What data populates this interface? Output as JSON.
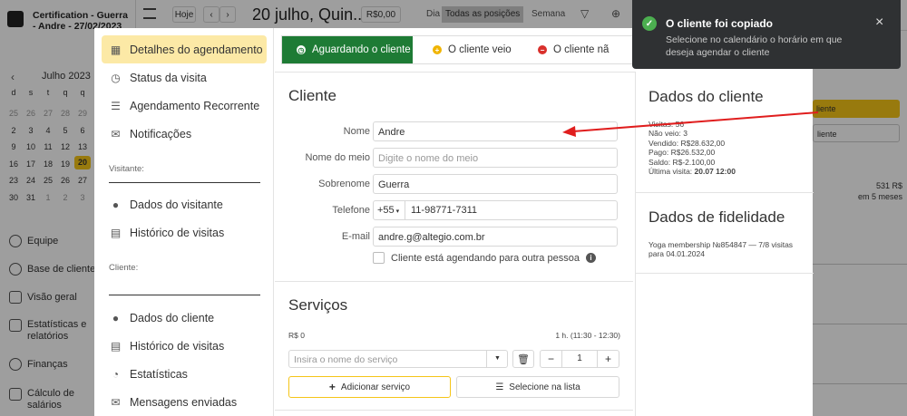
{
  "background": {
    "certification": "Certification - Guerra - Andre - 27/02/2023",
    "today_button": "Hoje",
    "date_title": "20 julho, Quin...",
    "price_pill": "R$0,00",
    "view_day": "Dia",
    "view_positions": "Todas as posições",
    "view_week": "Semana",
    "month_label": "Julho 2023",
    "weekdays": [
      "d",
      "s",
      "t",
      "q",
      "q"
    ],
    "calendar_rows": [
      [
        "25",
        "26",
        "27",
        "28",
        "29"
      ],
      [
        "2",
        "3",
        "4",
        "5",
        "6"
      ],
      [
        "9",
        "10",
        "11",
        "12",
        "13"
      ],
      [
        "16",
        "17",
        "18",
        "19",
        "20"
      ],
      [
        "23",
        "24",
        "25",
        "26",
        "27"
      ],
      [
        "30",
        "31",
        "1",
        "2",
        "3"
      ]
    ],
    "nav": [
      "Equipe",
      "Base de clientes",
      "Visão geral",
      "Estatísticas e relatórios",
      "Finanças",
      "Cálculo de salários"
    ],
    "right_snippets": [
      "liente",
      "liente",
      "531 R$",
      "em 5 meses"
    ]
  },
  "modal": {
    "sidebar": {
      "items_top": [
        {
          "label": "Detalhes do agendamento",
          "icon": "calendar-icon"
        },
        {
          "label": "Status da visita",
          "icon": "clock-icon"
        },
        {
          "label": "Agendamento Recorrente",
          "icon": "list-icon"
        },
        {
          "label": "Notificações",
          "icon": "chat-icon"
        }
      ],
      "visitor_label": "Visitante:",
      "items_visitor": [
        {
          "label": "Dados do visitante",
          "icon": "user-icon"
        },
        {
          "label": "Histórico de visitas",
          "icon": "history-icon"
        }
      ],
      "client_label": "Cliente:",
      "items_client": [
        {
          "label": "Dados do cliente",
          "icon": "user-icon"
        },
        {
          "label": "Histórico de visitas",
          "icon": "history-icon"
        },
        {
          "label": "Estatísticas",
          "icon": "pie-icon"
        },
        {
          "label": "Mensagens enviadas",
          "icon": "mail-icon"
        }
      ]
    },
    "tabs": {
      "waiting": "Aguardando o cliente",
      "came": "O cliente veio",
      "not_came": "O cliente nã"
    },
    "client": {
      "heading": "Cliente",
      "name_label": "Nome",
      "name_value": "Andre",
      "middle_label": "Nome do meio",
      "middle_placeholder": "Digite o nome do meio",
      "surname_label": "Sobrenome",
      "surname_value": "Guerra",
      "phone_label": "Telefone",
      "phone_code": "+55",
      "phone_value": "11-98771-7311",
      "email_label": "E-mail",
      "email_value": "andre.g@altegio.com.br",
      "other_person_label": "Cliente está agendando para outra pessoa"
    },
    "services": {
      "heading": "Serviços",
      "price": "R$ 0",
      "duration": "1 h. (11:30 - 12:30)",
      "service_placeholder": "Insira o nome do serviço",
      "quantity": "1",
      "add_service": "Adicionar serviço",
      "select_list": "Selecione na lista"
    },
    "client_data": {
      "heading": "Dados do cliente",
      "lines": [
        "Visitas: 56",
        "Não veio: 3",
        "Vendido: R$28.632,00",
        "Pago: R$26.532,00",
        "Saldo: R$-2.100,00"
      ],
      "last_visit_label": "Última visita: ",
      "last_visit_value": "20.07 12:00"
    },
    "loyalty": {
      "heading": "Dados de fidelidade",
      "text": "Yoga membership №854847 — 7/8 visitas para 04.01.2024"
    }
  },
  "toast": {
    "title": "O cliente foi copiado",
    "message": "Selecione no calendário o horário em que deseja agendar o cliente",
    "close": "×"
  },
  "colors": {
    "accent_green": "#1e7b35",
    "active_nav": "#fce9a6",
    "toast_bg": "#2f3133",
    "arrow": "#e01e1e",
    "highlight_yellow": "#f5c518"
  }
}
